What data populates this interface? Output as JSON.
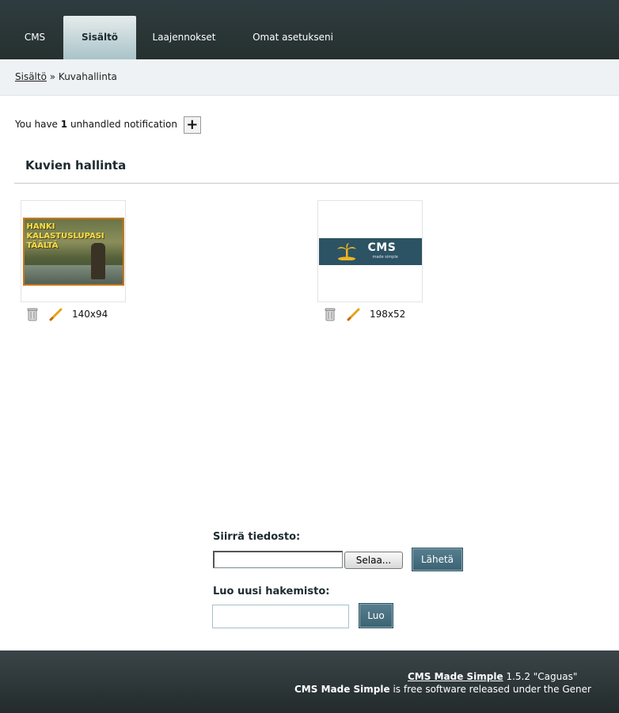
{
  "nav": {
    "tabs": [
      {
        "label": "CMS",
        "active": false
      },
      {
        "label": "Sisältö",
        "active": true
      },
      {
        "label": "Laajennokset",
        "active": false
      },
      {
        "label": "Omat asetukseni",
        "active": false
      }
    ]
  },
  "breadcrumb": {
    "parent": "Sisältö",
    "separator": " » ",
    "current": "Kuvahallinta"
  },
  "notification": {
    "prefix": "You have ",
    "count": "1",
    "suffix": " unhandled notification",
    "toggle": "+"
  },
  "page": {
    "title": "Kuvien hallinta"
  },
  "images": [
    {
      "dimensions": "140x94",
      "overlay_text": [
        "HANKI",
        "KALASTUSLUPASI",
        "TÄÄLTÄ"
      ]
    },
    {
      "dimensions": "198x52",
      "logo_text": "CMS",
      "logo_subtext": "made simple"
    }
  ],
  "upload": {
    "label": "Siirrä tiedosto:",
    "file_value": "",
    "browse_label": "Selaa...",
    "submit_label": "Lähetä"
  },
  "newdir": {
    "label": "Luo uusi hakemisto:",
    "value": "",
    "create_label": "Luo"
  },
  "footer": {
    "product_link": "CMS Made Simple",
    "version": " 1.5.2 \"Caguas\"",
    "line2_strong": "CMS Made Simple",
    "line2_rest": " is free software released under the Gener"
  },
  "colors": {
    "nav_bg": "#2f3c3f",
    "active_tab": "#a9c3c9",
    "button": "#3c6372",
    "footer_bg": "#2b3536"
  }
}
